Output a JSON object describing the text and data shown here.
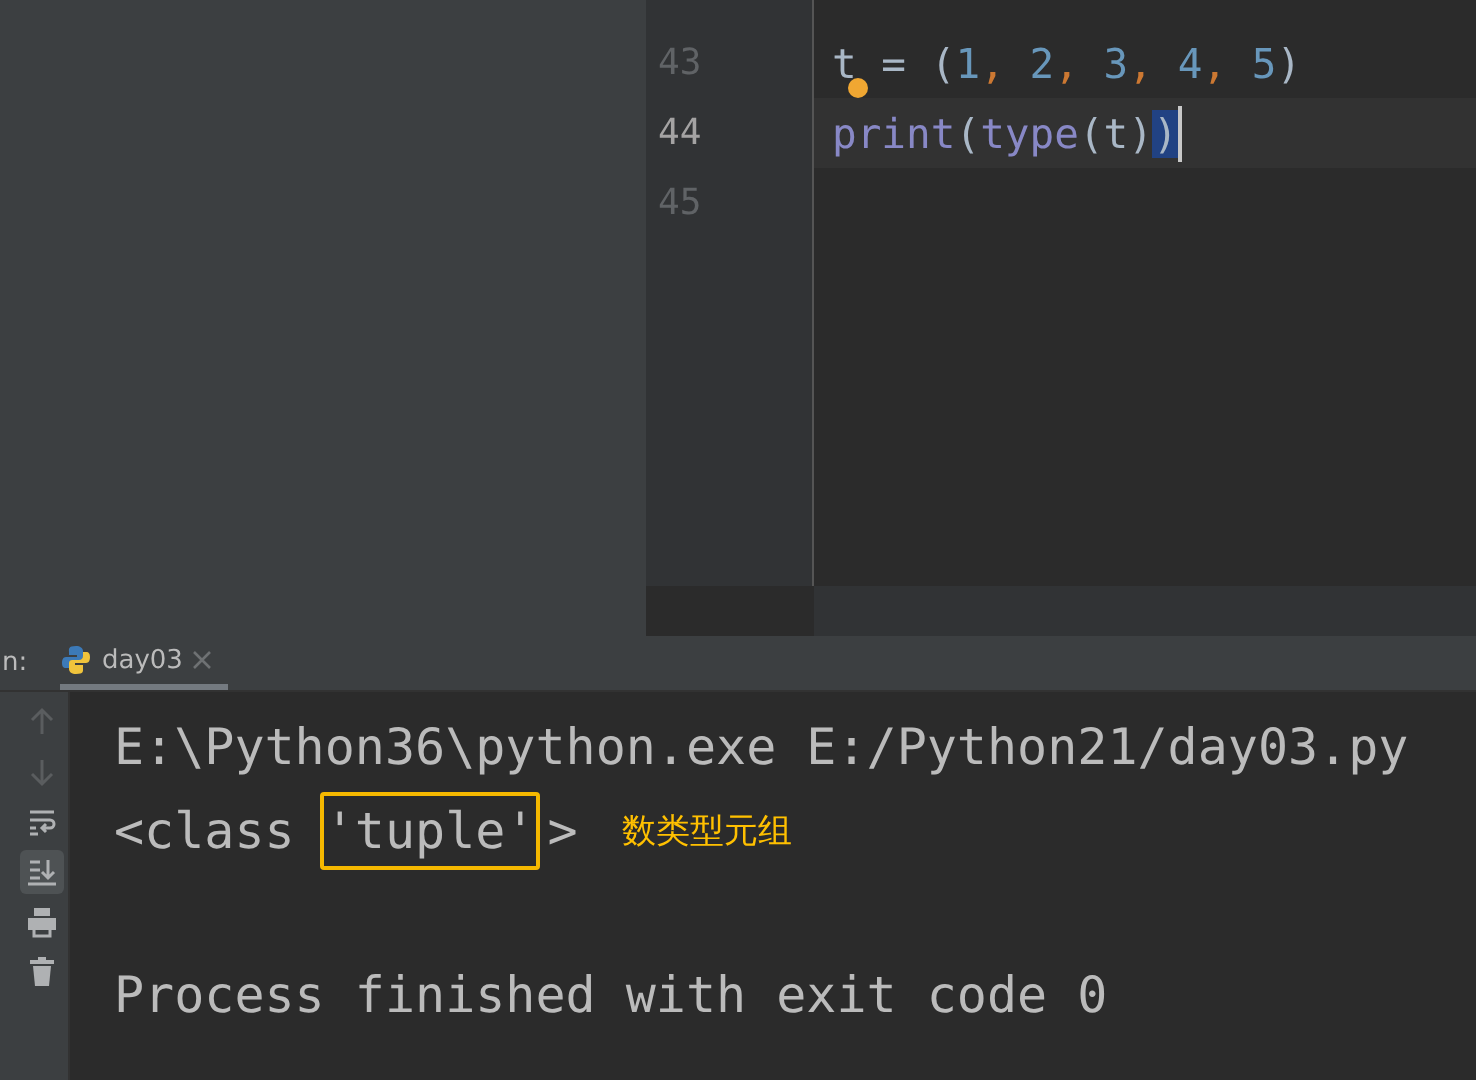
{
  "editor": {
    "lines": [
      {
        "number": "43",
        "current": false,
        "bulb": true,
        "tokens": [
          {
            "text": "t",
            "kind": "name"
          },
          {
            "text": " = (",
            "kind": "plain"
          },
          {
            "text": "1",
            "kind": "number"
          },
          {
            "text": ", ",
            "kind": "comma"
          },
          {
            "text": "2",
            "kind": "number"
          },
          {
            "text": ", ",
            "kind": "comma"
          },
          {
            "text": "3",
            "kind": "number"
          },
          {
            "text": ", ",
            "kind": "comma"
          },
          {
            "text": "4",
            "kind": "number"
          },
          {
            "text": ", ",
            "kind": "comma"
          },
          {
            "text": "5",
            "kind": "number"
          },
          {
            "text": ")",
            "kind": "plain"
          }
        ]
      },
      {
        "number": "44",
        "current": true,
        "tokens": [
          {
            "text": "print",
            "kind": "builtin"
          },
          {
            "text": "(",
            "kind": "plain"
          },
          {
            "text": "type",
            "kind": "builtin"
          },
          {
            "text": "(t)",
            "kind": "plain"
          },
          {
            "text": ")",
            "kind": "matched"
          }
        ]
      },
      {
        "number": "45",
        "current": false
      }
    ]
  },
  "run_panel": {
    "label": "n:",
    "tabs": [
      {
        "label": "day03",
        "selected": true
      }
    ],
    "toolbar": [
      {
        "kind": "up",
        "disabled": true,
        "selected": false
      },
      {
        "kind": "down",
        "disabled": true,
        "selected": false
      },
      {
        "kind": "wrap",
        "disabled": false,
        "selected": false
      },
      {
        "kind": "scroll-end",
        "disabled": false,
        "selected": true
      },
      {
        "kind": "print",
        "disabled": false,
        "selected": false
      },
      {
        "kind": "trash",
        "disabled": false,
        "selected": false
      }
    ],
    "output": [
      {
        "kind": "command",
        "segments": [
          {
            "text": "E:\\Python36\\python.exe E:/Python21/day03.py",
            "kind": "plain"
          }
        ]
      },
      {
        "kind": "result",
        "segments": [
          {
            "text": "<class ",
            "kind": "plain"
          },
          {
            "text": "'tuple'",
            "kind": "boxed"
          },
          {
            "text": ">",
            "kind": "plain"
          }
        ],
        "note": "数类型元组"
      },
      {
        "kind": "exit",
        "segments": [
          {
            "text": "Process finished with exit code 0",
            "kind": "plain"
          }
        ]
      }
    ]
  }
}
